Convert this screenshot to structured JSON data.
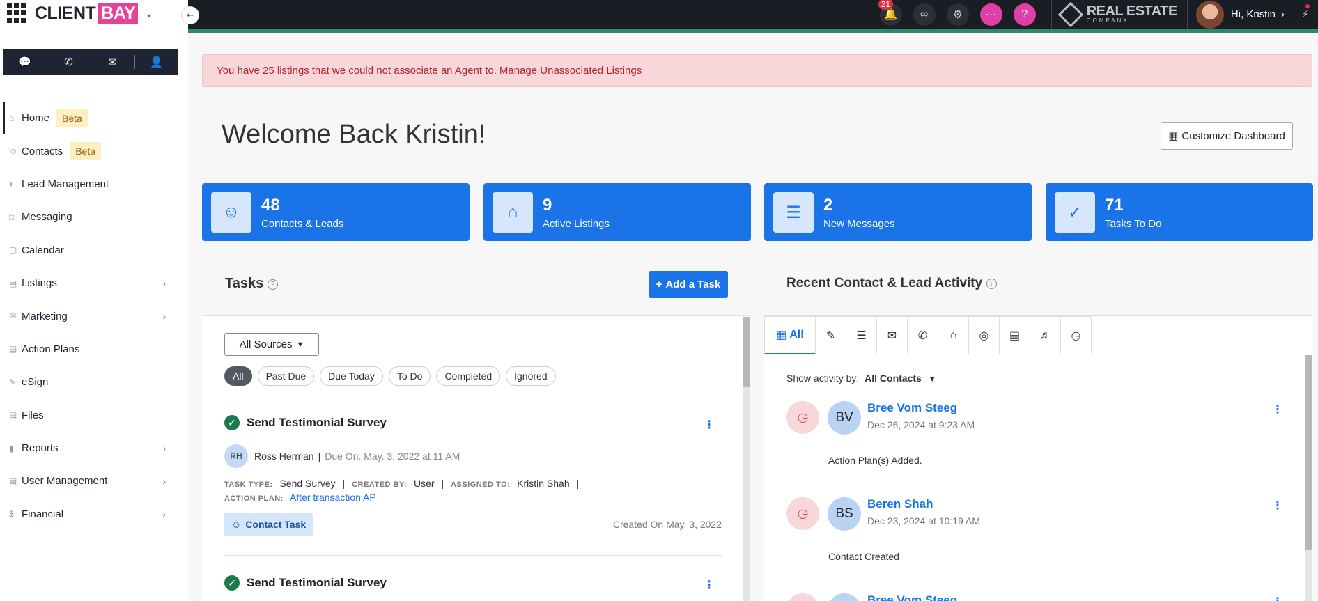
{
  "brand": {
    "name_part1": "CLIENT",
    "name_part2": "BAY"
  },
  "comm_bar": {
    "icons": [
      "chat-icon",
      "phone-icon",
      "mail-icon",
      "add-contact-icon"
    ]
  },
  "nav": {
    "items": [
      {
        "label": "Home",
        "badge": "Beta"
      },
      {
        "label": "Contacts",
        "badge": "Beta"
      },
      {
        "label": "Lead Management"
      },
      {
        "label": "Messaging"
      },
      {
        "label": "Calendar"
      },
      {
        "label": "Listings",
        "has_children": true
      },
      {
        "label": "Marketing",
        "has_children": true
      },
      {
        "label": "Action Plans"
      },
      {
        "label": "eSign"
      },
      {
        "label": "Files"
      },
      {
        "label": "Reports",
        "has_children": true
      },
      {
        "label": "User Management",
        "has_children": true
      },
      {
        "label": "Financial",
        "has_children": true
      }
    ]
  },
  "topbar": {
    "notifications_count": "21",
    "company": {
      "name": "REAL ESTATE",
      "sub": "COMPANY"
    },
    "greeting": "Hi, Kristin",
    "colors": {
      "background": "#1a1d24",
      "accent": "#2a8a6a",
      "pink": "#e03fa8"
    }
  },
  "alert": {
    "prefix": "You have",
    "link_count": "25 listings",
    "middle": "that we could not associate an Agent to.",
    "link_manage": "Manage Unassociated Listings"
  },
  "welcome": {
    "title": "Welcome Back Kristin!",
    "customize_label": "Customize Dashboard"
  },
  "stats": [
    {
      "value": "48",
      "label": "Contacts & Leads",
      "icon": "people-icon"
    },
    {
      "value": "9",
      "label": "Active Listings",
      "icon": "house-icon"
    },
    {
      "value": "2",
      "label": "New Messages",
      "icon": "message-icon"
    },
    {
      "value": "71",
      "label": "Tasks To Do",
      "icon": "check-circle-icon"
    }
  ],
  "tasks": {
    "title": "Tasks",
    "add_label": "Add a Task",
    "sources_label": "All Sources",
    "filters": [
      "All",
      "Past Due",
      "Due Today",
      "To Do",
      "Completed",
      "Ignored"
    ],
    "items": [
      {
        "title": "Send Testimonial Survey",
        "initials": "RH",
        "person": "Ross Herman",
        "due": "Due On: May. 3, 2022 at 11 AM",
        "task_type_label": "TASK TYPE:",
        "task_type": "Send Survey",
        "created_by_label": "CREATED BY:",
        "created_by": "User",
        "assigned_to_label": "ASSIGNED TO:",
        "assigned_to": "Kristin Shah",
        "action_plan_label": "ACTION PLAN:",
        "action_plan": "After transaction AP",
        "tag": "Contact Task",
        "created_on": "Created On May. 3, 2022"
      },
      {
        "title": "Send Testimonial Survey"
      }
    ]
  },
  "recent": {
    "title": "Recent Contact & Lead Activity",
    "tab_all_label": "All",
    "tabs_icons": [
      "note-icon",
      "chat-icon",
      "mail-icon",
      "phone-icon",
      "house-icon",
      "globe-icon",
      "document-icon",
      "bell-icon",
      "clock-icon"
    ],
    "show_by_label": "Show activity by:",
    "show_by_value": "All Contacts",
    "items": [
      {
        "initials": "BV",
        "name": "Bree Vom Steeg",
        "date": "Dec 26, 2024 at 9:23 AM",
        "text": "Action Plan(s) Added."
      },
      {
        "initials": "BS",
        "name": "Beren Shah",
        "date": "Dec 23, 2024 at 10:19 AM",
        "text": "Contact Created"
      },
      {
        "initials": "BV",
        "name": "Bree Vom Steeg"
      }
    ]
  }
}
